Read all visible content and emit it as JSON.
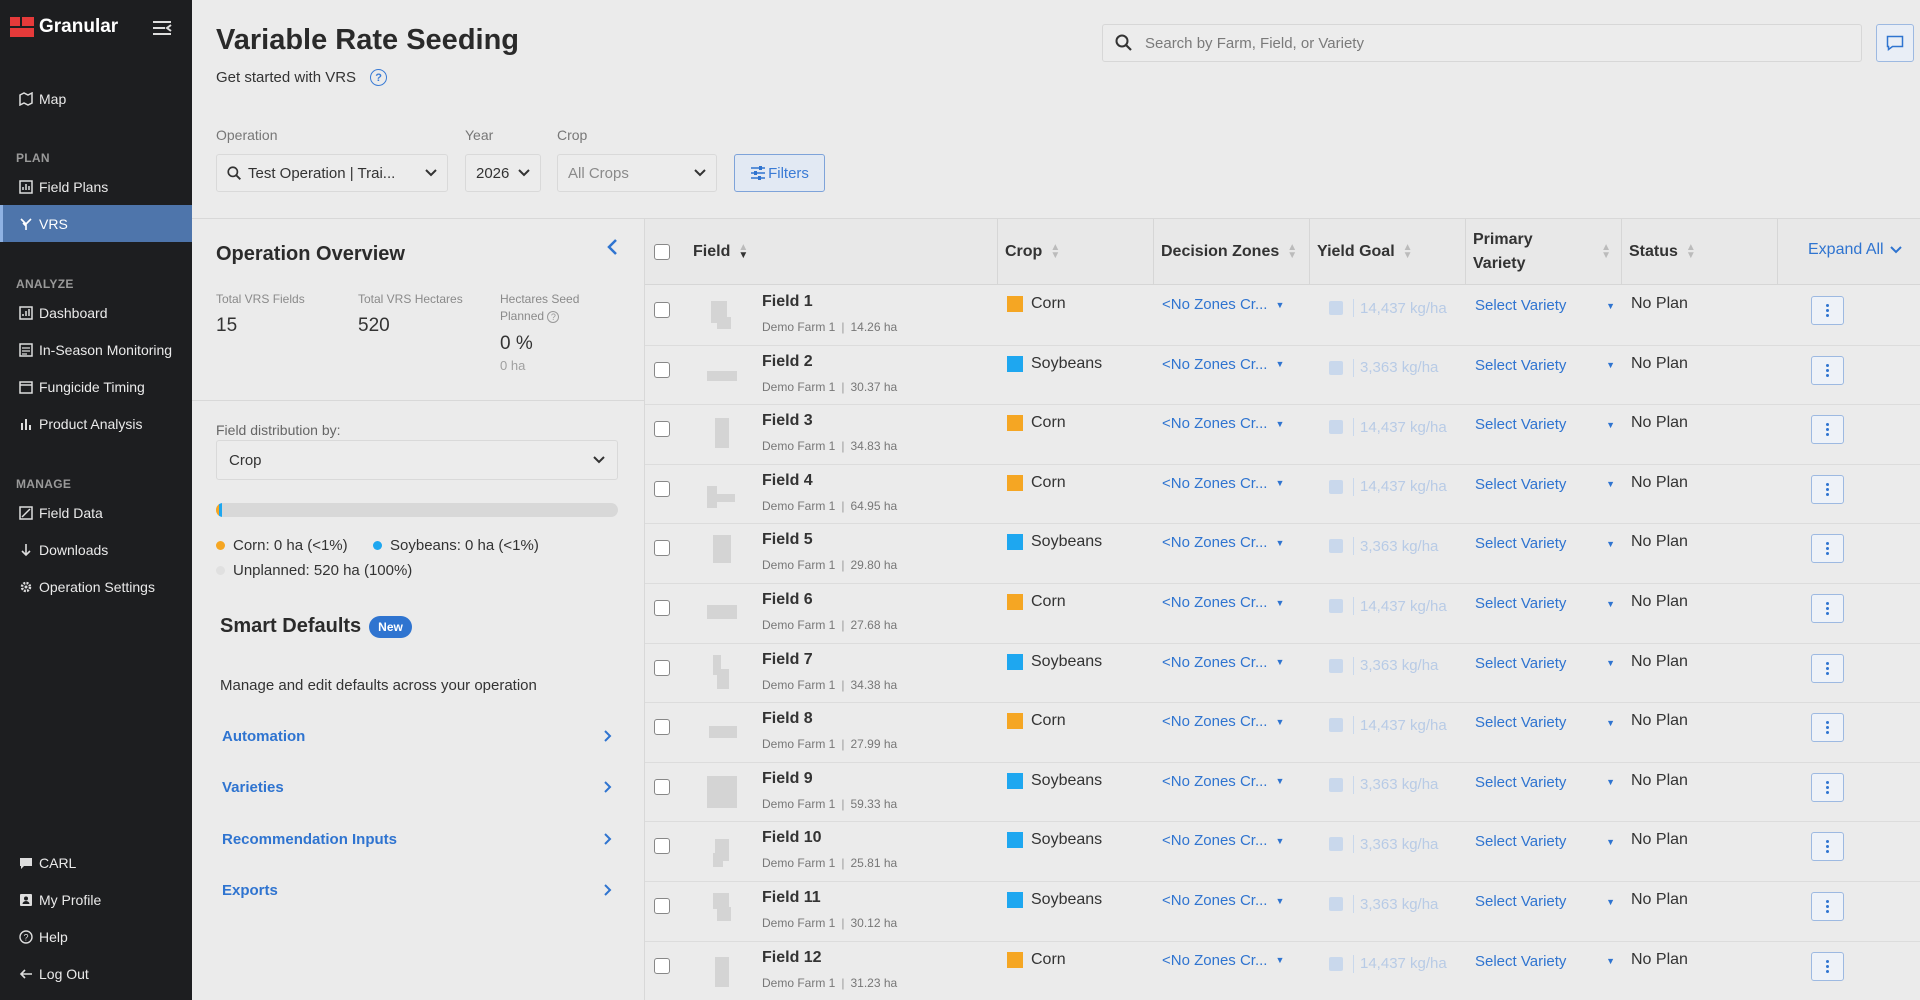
{
  "app": {
    "name": "Granular"
  },
  "sidebar": {
    "top": [
      {
        "label": "Map",
        "icon": "map-icon"
      }
    ],
    "plan": {
      "heading": "PLAN",
      "items": [
        {
          "label": "Field Plans",
          "icon": "field-plans-icon"
        },
        {
          "label": "VRS",
          "icon": "vrs-icon",
          "active": true
        }
      ]
    },
    "analyze": {
      "heading": "ANALYZE",
      "items": [
        {
          "label": "Dashboard"
        },
        {
          "label": "In-Season Monitoring"
        },
        {
          "label": "Fungicide Timing"
        },
        {
          "label": "Product Analysis"
        }
      ]
    },
    "manage": {
      "heading": "MANAGE",
      "items": [
        {
          "label": "Field Data"
        },
        {
          "label": "Downloads"
        },
        {
          "label": "Operation Settings"
        }
      ]
    },
    "bottom": [
      {
        "label": "CARL"
      },
      {
        "label": "My Profile"
      },
      {
        "label": "Help"
      },
      {
        "label": "Log Out"
      }
    ]
  },
  "header": {
    "title": "Variable Rate Seeding",
    "subtitle": "Get started with VRS",
    "search_placeholder": "Search by Farm, Field, or Variety"
  },
  "filters": {
    "operation_label": "Operation",
    "operation_value": "Test Operation | Trai...",
    "year_label": "Year",
    "year_value": "2026",
    "crop_label": "Crop",
    "crop_value": "All Crops",
    "filters_button": "Filters"
  },
  "overview": {
    "title": "Operation Overview",
    "stats": [
      {
        "label": "Total VRS Fields",
        "value": "15"
      },
      {
        "label": "Total VRS Hectares",
        "value": "520"
      },
      {
        "label": "Hectares Seed Planned",
        "value": "0 %",
        "sub": "0 ha"
      }
    ],
    "distribution_label": "Field distribution by:",
    "distribution_value": "Crop",
    "legend": [
      {
        "label": "Corn: 0 ha (<1%)",
        "color": "#f5a623"
      },
      {
        "label": "Soybeans: 0 ha (<1%)",
        "color": "#1ea7f0"
      },
      {
        "label": "Unplanned: 520 ha (100%)",
        "color": "#e0e0e0"
      }
    ]
  },
  "smart_defaults": {
    "title": "Smart Defaults",
    "badge": "New",
    "description": "Manage and edit defaults across your operation",
    "links": [
      "Automation",
      "Varieties",
      "Recommendation Inputs",
      "Exports"
    ]
  },
  "table": {
    "headers": {
      "field": "Field",
      "crop": "Crop",
      "zones": "Decision Zones",
      "yield": "Yield Goal",
      "variety_1": "Primary",
      "variety_2": "Variety",
      "status": "Status",
      "expand_all": "Expand All"
    },
    "rows": [
      {
        "name": "Field 1",
        "farm": "Demo Farm 1",
        "area": "14.26 ha",
        "crop": "Corn",
        "zones": "<No Zones Cr...",
        "yield": "14,437 kg/ha",
        "variety": "Select Variety",
        "status": "No Plan"
      },
      {
        "name": "Field 2",
        "farm": "Demo Farm 1",
        "area": "30.37 ha",
        "crop": "Soybeans",
        "zones": "<No Zones Cr...",
        "yield": "3,363 kg/ha",
        "variety": "Select Variety",
        "status": "No Plan"
      },
      {
        "name": "Field 3",
        "farm": "Demo Farm 1",
        "area": "34.83 ha",
        "crop": "Corn",
        "zones": "<No Zones Cr...",
        "yield": "14,437 kg/ha",
        "variety": "Select Variety",
        "status": "No Plan"
      },
      {
        "name": "Field 4",
        "farm": "Demo Farm 1",
        "area": "64.95 ha",
        "crop": "Corn",
        "zones": "<No Zones Cr...",
        "yield": "14,437 kg/ha",
        "variety": "Select Variety",
        "status": "No Plan"
      },
      {
        "name": "Field 5",
        "farm": "Demo Farm 1",
        "area": "29.80 ha",
        "crop": "Soybeans",
        "zones": "<No Zones Cr...",
        "yield": "3,363 kg/ha",
        "variety": "Select Variety",
        "status": "No Plan"
      },
      {
        "name": "Field 6",
        "farm": "Demo Farm 1",
        "area": "27.68 ha",
        "crop": "Corn",
        "zones": "<No Zones Cr...",
        "yield": "14,437 kg/ha",
        "variety": "Select Variety",
        "status": "No Plan"
      },
      {
        "name": "Field 7",
        "farm": "Demo Farm 1",
        "area": "34.38 ha",
        "crop": "Soybeans",
        "zones": "<No Zones Cr...",
        "yield": "3,363 kg/ha",
        "variety": "Select Variety",
        "status": "No Plan"
      },
      {
        "name": "Field 8",
        "farm": "Demo Farm 1",
        "area": "27.99 ha",
        "crop": "Corn",
        "zones": "<No Zones Cr...",
        "yield": "14,437 kg/ha",
        "variety": "Select Variety",
        "status": "No Plan"
      },
      {
        "name": "Field 9",
        "farm": "Demo Farm 1",
        "area": "59.33 ha",
        "crop": "Soybeans",
        "zones": "<No Zones Cr...",
        "yield": "3,363 kg/ha",
        "variety": "Select Variety",
        "status": "No Plan"
      },
      {
        "name": "Field 10",
        "farm": "Demo Farm 1",
        "area": "25.81 ha",
        "crop": "Soybeans",
        "zones": "<No Zones Cr...",
        "yield": "3,363 kg/ha",
        "variety": "Select Variety",
        "status": "No Plan"
      },
      {
        "name": "Field 11",
        "farm": "Demo Farm 1",
        "area": "30.12 ha",
        "crop": "Soybeans",
        "zones": "<No Zones Cr...",
        "yield": "3,363 kg/ha",
        "variety": "Select Variety",
        "status": "No Plan"
      },
      {
        "name": "Field 12",
        "farm": "Demo Farm 1",
        "area": "31.23 ha",
        "crop": "Corn",
        "zones": "<No Zones Cr...",
        "yield": "14,437 kg/ha",
        "variety": "Select Variety",
        "status": "No Plan"
      }
    ]
  },
  "colors": {
    "corn": "#f5a623",
    "soybeans": "#1ea7f0",
    "accent": "#2f74d0",
    "sidebar": "#1d1e20",
    "active_nav": "#4e75ab"
  }
}
